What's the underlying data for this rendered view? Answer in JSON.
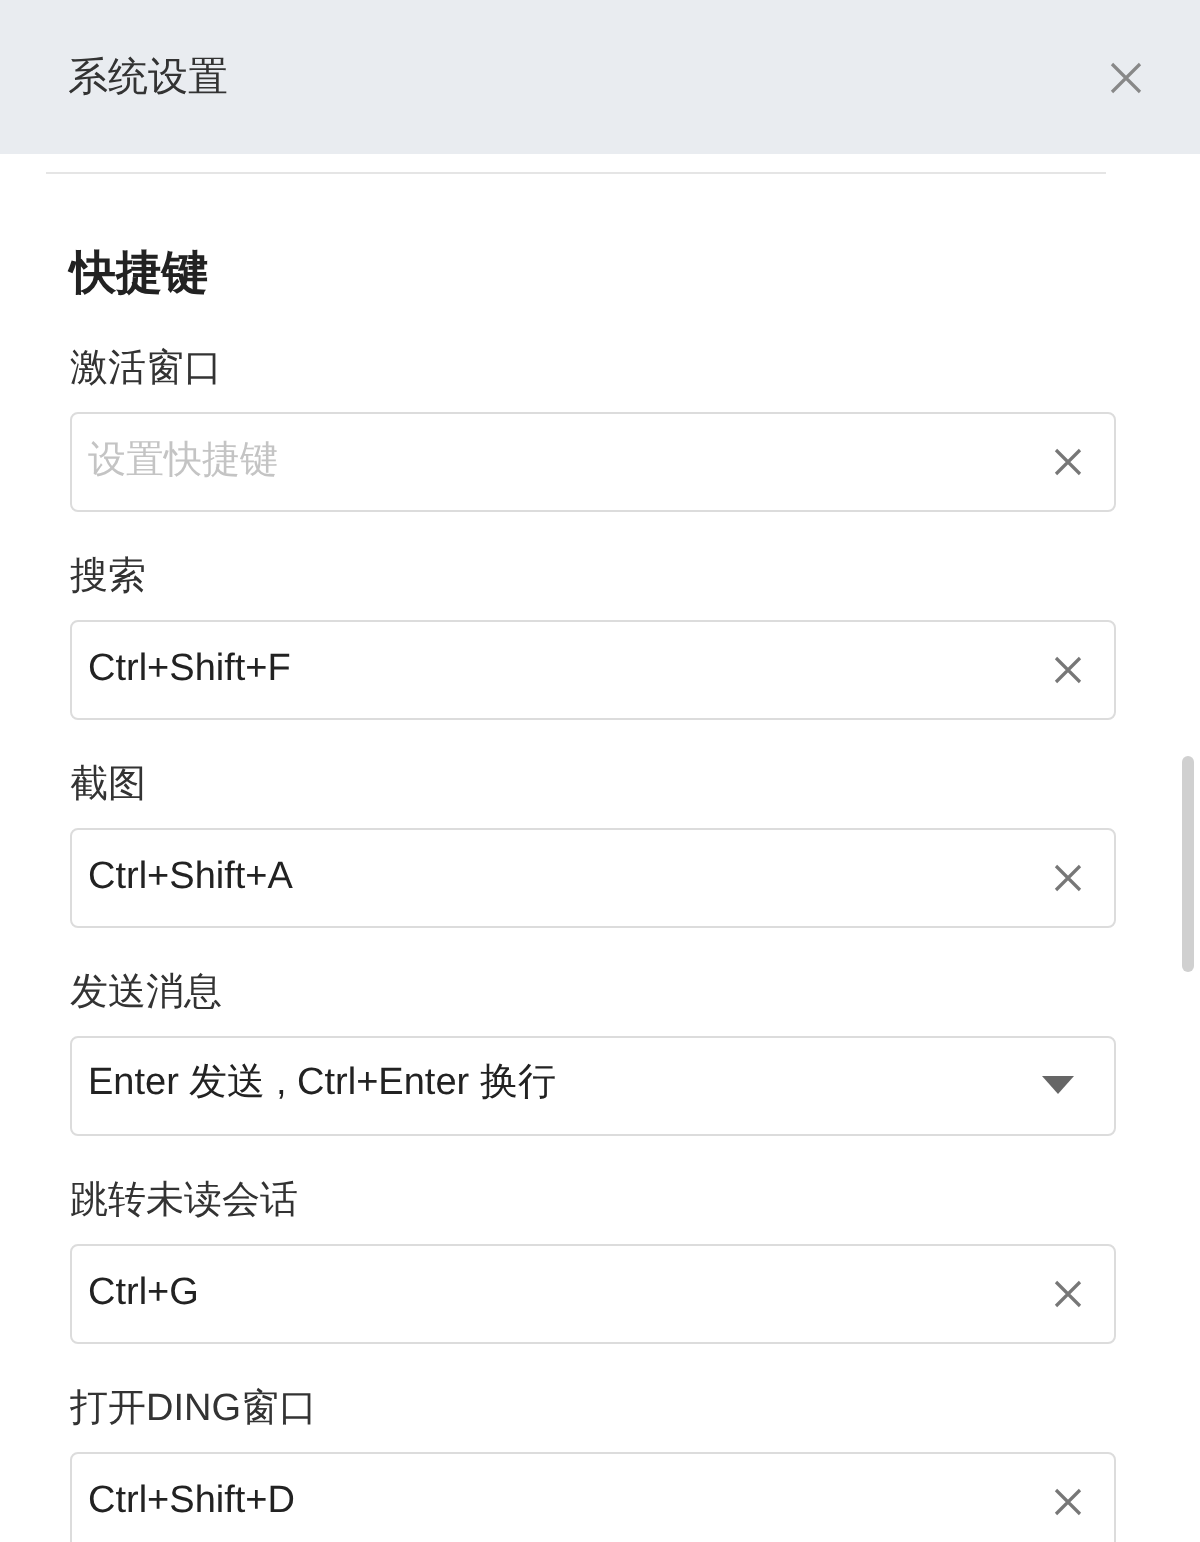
{
  "window": {
    "title": "系统设置"
  },
  "section": {
    "heading": "快捷键"
  },
  "fields": [
    {
      "label": "激活窗口",
      "kind": "shortcut",
      "placeholder": "设置快捷键"
    },
    {
      "label": "搜索",
      "kind": "shortcut",
      "value": "Ctrl+Shift+F"
    },
    {
      "label": "截图",
      "kind": "shortcut",
      "value": "Ctrl+Shift+A"
    },
    {
      "label": "发送消息",
      "kind": "select",
      "value": "Enter 发送 , Ctrl+Enter 换行"
    },
    {
      "label": "跳转未读会话",
      "kind": "shortcut",
      "value": "Ctrl+G"
    },
    {
      "label": "打开DING窗口",
      "kind": "shortcut",
      "value": "Ctrl+Shift+D"
    }
  ]
}
